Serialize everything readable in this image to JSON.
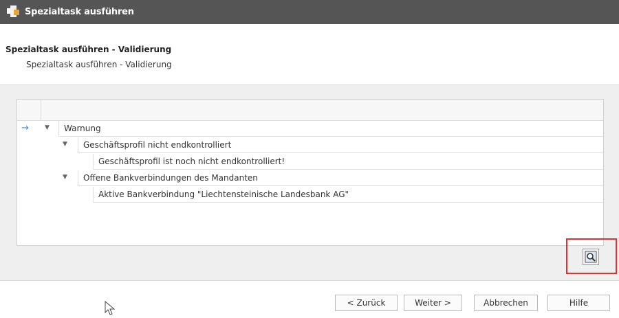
{
  "window": {
    "title": "Spezialtask ausführen"
  },
  "header": {
    "title": "Spezialtask ausführen - Validierung",
    "subtitle": "Spezialtask ausführen - Validierung"
  },
  "tree": {
    "rows": [
      {
        "label": "Warnung",
        "level": 0,
        "expanded": true,
        "current": true
      },
      {
        "label": "Geschäftsprofil nicht endkontrolliert",
        "level": 1,
        "expanded": true
      },
      {
        "label": "Geschäftsprofil ist noch nicht endkontrolliert!",
        "level": 2
      },
      {
        "label": "Offene Bankverbindungen des Mandanten",
        "level": 1,
        "expanded": true
      },
      {
        "label": "Aktive Bankverbindung \"Liechtensteinische Landesbank AG\"",
        "level": 2
      }
    ]
  },
  "icons": {
    "row_indicator": "arrow-right-icon",
    "expand": "chevron-down-icon",
    "details": "magnifier-icon",
    "app": "app-logo-icon"
  },
  "colors": {
    "titlebar": "#555555",
    "highlight": "#e03232",
    "row_indicator": "#2e86d9"
  },
  "footer": {
    "back_label": "< Zurück",
    "next_label": "Weiter >",
    "cancel_label": "Abbrechen",
    "help_label": "Hilfe"
  }
}
